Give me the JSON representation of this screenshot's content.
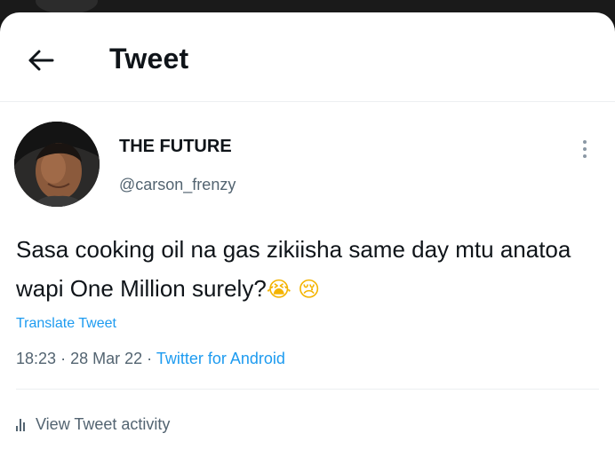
{
  "header": {
    "title": "Tweet",
    "back_icon": "arrow-left-icon"
  },
  "author": {
    "display_name": "THE FUTURE",
    "handle": "@carson_frenzy"
  },
  "tweet": {
    "text": "Sasa cooking oil na gas zikiisha same day mtu anatoa wapi One Million surely?",
    "emojis": [
      "😭",
      "😢"
    ],
    "translate_label": "Translate Tweet",
    "time": "18:23",
    "date": "28 Mar 22",
    "separator": "·",
    "source": "Twitter for Android"
  },
  "activity": {
    "label": "View Tweet activity",
    "icon": "bar-chart-icon"
  },
  "colors": {
    "accent": "#1d9bf0",
    "text_primary": "#0f1419",
    "text_secondary": "#536471"
  }
}
